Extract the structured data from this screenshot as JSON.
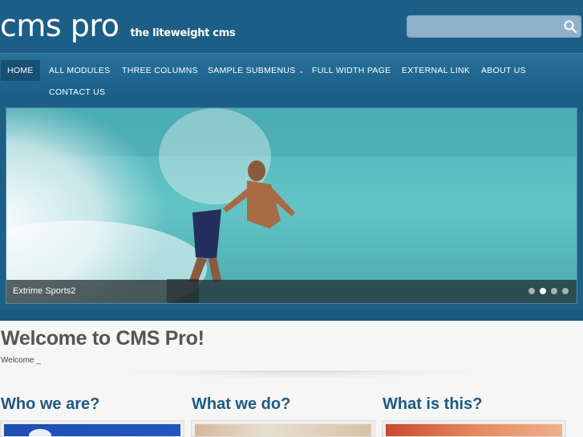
{
  "header": {
    "logo_main": "cms pro",
    "logo_tagline": "the liteweight cms",
    "search": {
      "value": "",
      "icon": "search-icon"
    }
  },
  "nav": {
    "items": [
      {
        "label": "HOME",
        "active": true
      },
      {
        "label": "ALL MODULES",
        "active": false
      },
      {
        "label": "THREE COLUMNS",
        "active": false
      },
      {
        "label": "SAMPLE SUBMENUS",
        "active": false,
        "has_caret": true
      },
      {
        "label": "FULL WIDTH PAGE",
        "active": false
      },
      {
        "label": "EXTERNAL LINK",
        "active": false
      },
      {
        "label": "ABOUT US",
        "active": false
      },
      {
        "label": "CONTACT US",
        "active": false
      }
    ],
    "caret": "⌄"
  },
  "slider": {
    "caption": "Extrime Sports2",
    "slide_count": 4,
    "active_slide": 2
  },
  "main": {
    "welcome_title": "Welcome to CMS Pro!",
    "welcome_text": "Welcome _",
    "columns": [
      {
        "title": "Who we are?"
      },
      {
        "title": "What we do?"
      },
      {
        "title": "What is this?"
      }
    ]
  },
  "colors": {
    "header_bg": "#1d5f87",
    "nav_active": "#184f73",
    "column_title": "#1e5a80"
  }
}
